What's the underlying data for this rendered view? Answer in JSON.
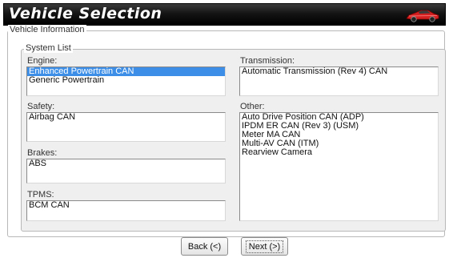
{
  "window": {
    "title": "Vehicle Selection",
    "icon": "red-sports-car-icon"
  },
  "vehicle_information": {
    "legend": "Vehicle Information"
  },
  "system_list": {
    "legend": "System List",
    "engine": {
      "label": "Engine:",
      "items": [
        "Enhanced Powertrain CAN",
        "Generic Powertrain"
      ],
      "selected": "Enhanced Powertrain CAN"
    },
    "transmission": {
      "label": "Transmission:",
      "items": [
        "Automatic Transmission (Rev 4) CAN"
      ]
    },
    "safety": {
      "label": "Safety:",
      "items": [
        "Airbag CAN"
      ]
    },
    "other": {
      "label": "Other:",
      "items": [
        "Auto Drive Position CAN (ADP)",
        "IPDM ER CAN (Rev 3) (USM)",
        "Meter MA CAN",
        "Multi-AV CAN (ITM)",
        "Rearview Camera"
      ]
    },
    "brakes": {
      "label": "Brakes:",
      "items": [
        "ABS"
      ]
    },
    "tpms": {
      "label": "TPMS:",
      "items": [
        "BCM CAN"
      ]
    }
  },
  "buttons": {
    "back": "Back (<)",
    "next": "Next (>)"
  },
  "colors": {
    "selection": "#3d8ee6",
    "titlebar": "#000000",
    "car": "#d42020"
  }
}
